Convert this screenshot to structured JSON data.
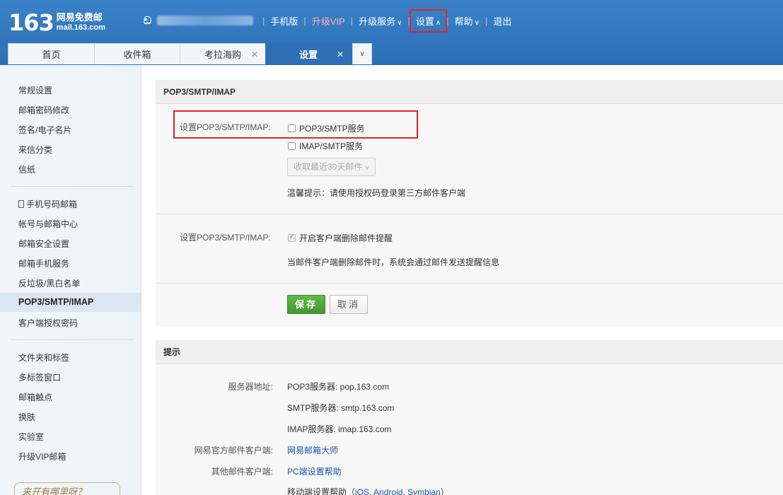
{
  "header": {
    "logo_number": "163",
    "logo_name": "网易免费邮",
    "logo_domain": "mail.163.com",
    "user_icon": "user-switch-icon",
    "nav": [
      {
        "label": "手机版"
      },
      {
        "label": "升级VIP"
      },
      {
        "label": "升级服务"
      },
      {
        "label": "设置"
      },
      {
        "label": "帮助"
      },
      {
        "label": "退出"
      }
    ]
  },
  "tabs": [
    {
      "label": "首页"
    },
    {
      "label": "收件箱"
    },
    {
      "label": "考拉海购"
    },
    {
      "label": "设置"
    }
  ],
  "sidebar": {
    "group1": [
      "常规设置",
      "邮箱密码修改",
      "签名/电子名片",
      "来信分类",
      "信纸"
    ],
    "group2": [
      "手机号码邮箱",
      "帐号与邮箱中心",
      "邮箱安全设置",
      "邮箱手机服务",
      "反垃圾/黑白名单",
      "POP3/SMTP/IMAP",
      "客户端授权密码"
    ],
    "group3": [
      "文件夹和标签",
      "多标签窗口",
      "邮箱触点",
      "换肤",
      "实验室",
      "升级VIP邮箱"
    ],
    "banner": "来开有哪里呀？"
  },
  "pop3": {
    "title": "POP3/SMTP/IMAP",
    "row1_label": "设置POP3/SMTP/IMAP:",
    "opt_pop3": "POP3/SMTP服务",
    "opt_imap": "IMAP/SMTP服务",
    "fetch_select": "收取最近30天邮件",
    "tip": "温馨提示：请使用授权码登录第三方邮件客户端",
    "row2_label": "设置POP3/SMTP/IMAP:",
    "delete_notice": "开启客户端删除邮件提醒",
    "delete_desc": "当邮件客户端删除邮件时，系统会通过邮件发送提醒信息",
    "save": "保存",
    "cancel": "取消"
  },
  "hints": {
    "title": "提示",
    "server_label": "服务器地址:",
    "pop3_server": "POP3服务器: pop.163.com",
    "smtp_server": "SMTP服务器: smtp.163.com",
    "imap_server": "IMAP服务器: imap.163.com",
    "official_label": "网易官方邮件客户端:",
    "official_link": "网易邮箱大师",
    "other_label": "其他邮件客户端:",
    "other_link": "PC端设置帮助",
    "mobile_prefix": "移动端设置帮助（",
    "mobile_ios": "iOS",
    "mobile_android": "Android",
    "mobile_symbian": "Symbian",
    "mobile_suffix": "）"
  }
}
